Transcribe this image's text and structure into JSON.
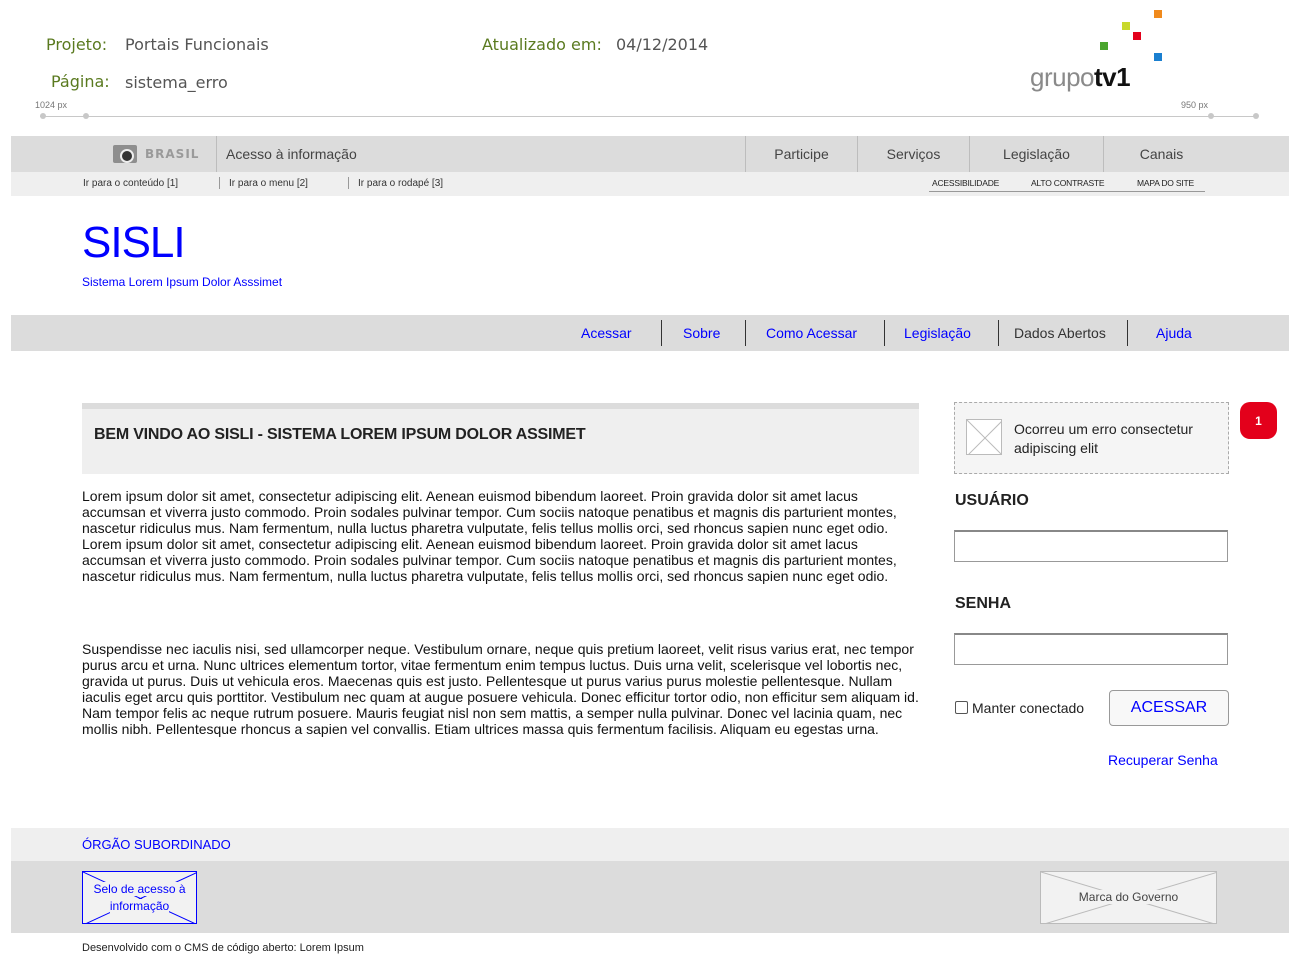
{
  "doc": {
    "projeto_label": "Projeto:",
    "projeto_value": "Portais Funcionais",
    "pagina_label": "Página:",
    "pagina_value": "sistema_erro",
    "atualizado_label": "Atualizado em:",
    "atualizado_value": "04/12/2014",
    "ruler_left": "1024 px",
    "ruler_right": "950 px"
  },
  "logo": {
    "prefix": "grupo",
    "suffix": "tv1"
  },
  "govbar": {
    "brasil": "BRASIL",
    "acesso_info": "Acesso à informação",
    "menu": [
      "Participe",
      "Serviços",
      "Legislação",
      "Canais"
    ]
  },
  "skip_links": [
    "Ir para o conteúdo [1]",
    "Ir para o menu [2]",
    "Ir para o rodapé [3]"
  ],
  "accessibility_links": [
    "ACESSIBILIDADE",
    "ALTO CONTRASTE",
    "MAPA DO SITE"
  ],
  "site": {
    "title": "SISLI",
    "subtitle": "Sistema Lorem Ipsum Dolor Asssimet"
  },
  "menu": [
    "Acessar",
    "Sobre",
    "Como Acessar",
    "Legislação",
    "Dados Abertos",
    "Ajuda"
  ],
  "content": {
    "title": "BEM VINDO AO SISLI - SISTEMA LOREM IPSUM DOLOR ASSIMET",
    "paragraph1": "Lorem ipsum dolor sit amet, consectetur adipiscing elit. Aenean euismod bibendum laoreet. Proin gravida dolor sit amet lacus accumsan et viverra justo commodo. Proin sodales pulvinar tempor. Cum sociis natoque penatibus et magnis dis parturient montes, nascetur ridiculus mus. Nam fermentum, nulla luctus pharetra vulputate, felis tellus mollis orci, sed rhoncus sapien nunc eget odio. Lorem ipsum dolor sit amet, consectetur adipiscing elit. Aenean euismod bibendum laoreet. Proin gravida dolor sit amet lacus accumsan et viverra justo commodo. Proin sodales pulvinar tempor. Cum sociis natoque penatibus et magnis dis parturient montes, nascetur ridiculus mus. Nam fermentum, nulla luctus pharetra vulputate, felis tellus mollis orci, sed rhoncus sapien nunc eget odio.",
    "paragraph2": "Suspendisse nec iaculis nisi, sed ullamcorper neque. Vestibulum ornare, neque quis pretium laoreet, velit risus varius erat, nec tempor purus arcu et urna. Nunc ultrices elementum tortor, vitae fermentum enim tempus luctus. Duis urna velit, scelerisque vel lobortis nec, gravida ut purus. Duis ut vehicula eros. Maecenas quis est justo. Pellentesque ut purus varius purus molestie pellentesque. Nullam iaculis eget arcu quis porttitor. Vestibulum nec quam at augue posuere vehicula. Donec efficitur tortor odio, non efficitur sem aliquam id. Nam tempor felis ac neque rutrum posuere. Mauris feugiat nisl non sem mattis, a semper nulla pulvinar. Donec vel lacinia quam, nec mollis nibh. Pellentesque rhoncus a sapien vel convallis. Etiam ultrices massa quis fermentum facilisis. Aliquam eu egestas urna."
  },
  "login": {
    "error_message": "Ocorreu um erro consectetur adipiscing elit",
    "badge": "1",
    "usuario_label": "USUÁRIO",
    "usuario_value": "",
    "senha_label": "SENHA",
    "senha_value": "",
    "remember_label": "Manter conectado",
    "submit_label": "ACESSAR",
    "recover_label": "Recuperar Senha"
  },
  "footer": {
    "orgao": "ÓRGÃO SUBORDINADO",
    "selo": "Selo de acesso à informação",
    "marca": "Marca do Governo",
    "developed": "Desenvolvido com o CMS de código aberto: Lorem Ipsum"
  },
  "colors": {
    "link": "#0000ff",
    "label_green": "#5a7a1f",
    "badge_red": "#e3001b"
  }
}
